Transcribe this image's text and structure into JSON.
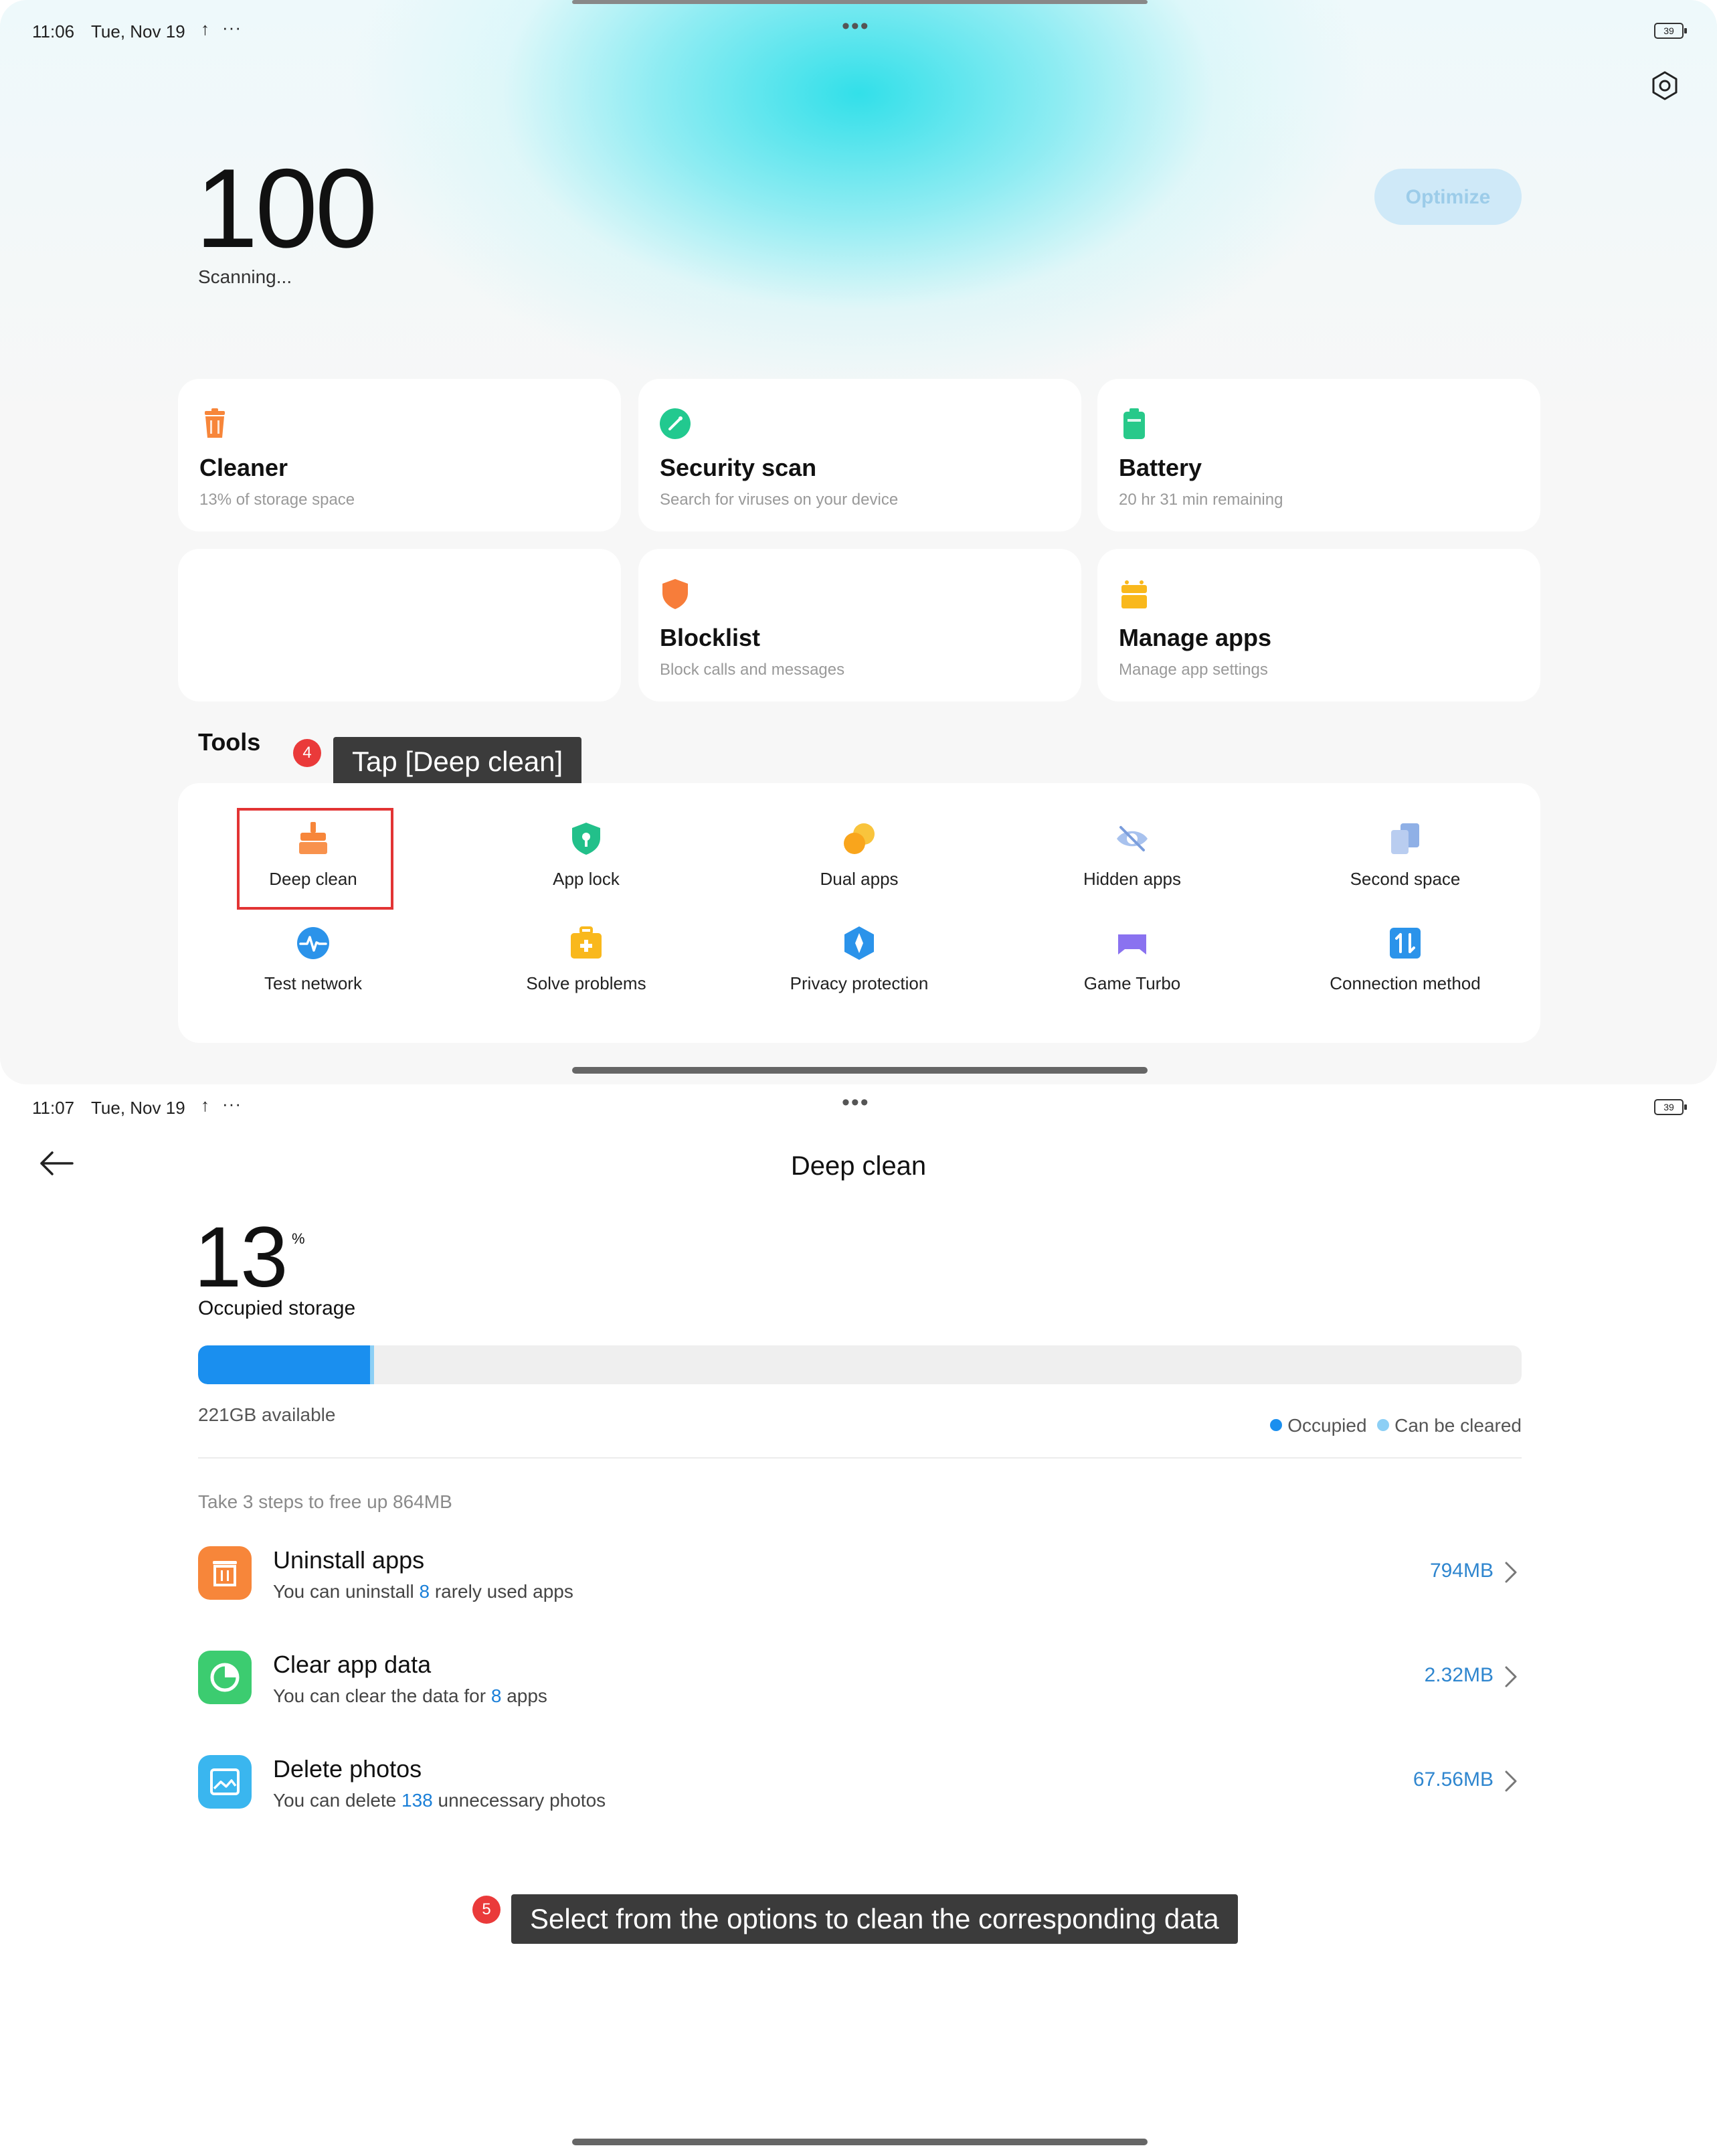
{
  "screen1": {
    "status": {
      "time": "11:06",
      "date": "Tue, Nov 19",
      "battery": "39"
    },
    "score": "100",
    "scan_status": "Scanning...",
    "optimize_label": "Optimize",
    "cards": [
      {
        "title": "Cleaner",
        "subtitle": "13% of storage space",
        "icon": "trash-icon",
        "color": "#f7863a"
      },
      {
        "title": "Security scan",
        "subtitle": "Search for viruses on your device",
        "icon": "shield-check-icon",
        "color": "#22c98f"
      },
      {
        "title": "Battery",
        "subtitle": "20 hr 31 min  remaining",
        "icon": "battery-icon",
        "color": "#28c98a"
      },
      {
        "title": "",
        "subtitle": "",
        "icon": "",
        "color": ""
      },
      {
        "title": "Blocklist",
        "subtitle": "Block calls and messages",
        "icon": "shield-icon",
        "color": "#f77d3a"
      },
      {
        "title": "Manage apps",
        "subtitle": "Manage app settings",
        "icon": "apps-icon",
        "color": "#f9b81c"
      }
    ],
    "tools_title": "Tools",
    "step4": {
      "number": "4",
      "text": "Tap [Deep clean]"
    },
    "tools": [
      {
        "label": "Deep clean",
        "icon": "broom-icon",
        "color": "#f7863a"
      },
      {
        "label": "App lock",
        "icon": "lock-shield-icon",
        "color": "#22c08a"
      },
      {
        "label": "Dual apps",
        "icon": "dual-circles-icon",
        "color": "#f9a51c"
      },
      {
        "label": "Hidden apps",
        "icon": "eye-off-icon",
        "color": "#8fb0e6"
      },
      {
        "label": "Second space",
        "icon": "layers-icon",
        "color": "#8fb0e6"
      },
      {
        "label": "Test network",
        "icon": "pulse-icon",
        "color": "#2b93ea"
      },
      {
        "label": "Solve problems",
        "icon": "toolbox-icon",
        "color": "#f9b81c"
      },
      {
        "label": "Privacy protection",
        "icon": "privacy-icon",
        "color": "#2b93ea"
      },
      {
        "label": "Game Turbo",
        "icon": "gamepad-icon",
        "color": "#8a72f0"
      },
      {
        "label": "Connection method",
        "icon": "arrows-updown-icon",
        "color": "#2b93ea"
      }
    ]
  },
  "screen2": {
    "status": {
      "time": "11:07",
      "date": "Tue, Nov 19",
      "battery": "39"
    },
    "title": "Deep clean",
    "storage_percent": "13",
    "percent_sign": "%",
    "occupied_label": "Occupied storage",
    "bar": {
      "occupied_fraction": 0.13,
      "clearable_fraction": 0.003
    },
    "available": "221GB available",
    "legend": {
      "occupied": "Occupied",
      "clearable": "Can be cleared",
      "occupied_color": "#1a8fef",
      "clearable_color": "#8ccff5"
    },
    "steps_hint": "Take 3 steps to free up 864MB",
    "rows": [
      {
        "title": "Uninstall apps",
        "sub_before": "You can uninstall ",
        "sub_num": "8",
        "sub_after": " rarely used apps",
        "size": "794MB",
        "icon": "uninstall-icon",
        "color": "#f7863a"
      },
      {
        "title": "Clear app data",
        "sub_before": "You can clear the data for ",
        "sub_num": "8",
        "sub_after": " apps",
        "size": "2.32MB",
        "icon": "pie-icon",
        "color": "#3ccc70"
      },
      {
        "title": "Delete photos",
        "sub_before": "You can delete ",
        "sub_num": "138",
        "sub_after": " unnecessary photos",
        "size": "67.56MB",
        "icon": "photo-icon",
        "color": "#3ab6ef"
      }
    ],
    "step5": {
      "number": "5",
      "text": "Select from the options to clean the corresponding data"
    }
  }
}
